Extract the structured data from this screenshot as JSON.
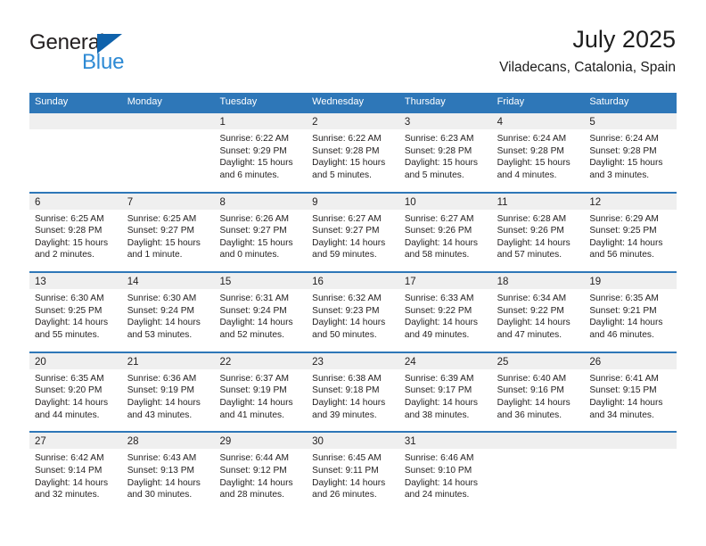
{
  "brand": {
    "name_part1": "General",
    "name_part2": "Blue",
    "accent_color": "#2e8ad4",
    "triangle_color": "#0f62ab"
  },
  "header": {
    "title": "July 2025",
    "subtitle": "Viladecans, Catalonia, Spain"
  },
  "calendar": {
    "header_color": "#2e77b8",
    "band_color": "#efefef",
    "weekdays": [
      "Sunday",
      "Monday",
      "Tuesday",
      "Wednesday",
      "Thursday",
      "Friday",
      "Saturday"
    ],
    "weeks": [
      [
        {
          "day": "",
          "sunrise": "",
          "sunset": "",
          "daylight1": "",
          "daylight2": ""
        },
        {
          "day": "",
          "sunrise": "",
          "sunset": "",
          "daylight1": "",
          "daylight2": ""
        },
        {
          "day": "1",
          "sunrise": "Sunrise: 6:22 AM",
          "sunset": "Sunset: 9:29 PM",
          "daylight1": "Daylight: 15 hours",
          "daylight2": "and 6 minutes."
        },
        {
          "day": "2",
          "sunrise": "Sunrise: 6:22 AM",
          "sunset": "Sunset: 9:28 PM",
          "daylight1": "Daylight: 15 hours",
          "daylight2": "and 5 minutes."
        },
        {
          "day": "3",
          "sunrise": "Sunrise: 6:23 AM",
          "sunset": "Sunset: 9:28 PM",
          "daylight1": "Daylight: 15 hours",
          "daylight2": "and 5 minutes."
        },
        {
          "day": "4",
          "sunrise": "Sunrise: 6:24 AM",
          "sunset": "Sunset: 9:28 PM",
          "daylight1": "Daylight: 15 hours",
          "daylight2": "and 4 minutes."
        },
        {
          "day": "5",
          "sunrise": "Sunrise: 6:24 AM",
          "sunset": "Sunset: 9:28 PM",
          "daylight1": "Daylight: 15 hours",
          "daylight2": "and 3 minutes."
        }
      ],
      [
        {
          "day": "6",
          "sunrise": "Sunrise: 6:25 AM",
          "sunset": "Sunset: 9:28 PM",
          "daylight1": "Daylight: 15 hours",
          "daylight2": "and 2 minutes."
        },
        {
          "day": "7",
          "sunrise": "Sunrise: 6:25 AM",
          "sunset": "Sunset: 9:27 PM",
          "daylight1": "Daylight: 15 hours",
          "daylight2": "and 1 minute."
        },
        {
          "day": "8",
          "sunrise": "Sunrise: 6:26 AM",
          "sunset": "Sunset: 9:27 PM",
          "daylight1": "Daylight: 15 hours",
          "daylight2": "and 0 minutes."
        },
        {
          "day": "9",
          "sunrise": "Sunrise: 6:27 AM",
          "sunset": "Sunset: 9:27 PM",
          "daylight1": "Daylight: 14 hours",
          "daylight2": "and 59 minutes."
        },
        {
          "day": "10",
          "sunrise": "Sunrise: 6:27 AM",
          "sunset": "Sunset: 9:26 PM",
          "daylight1": "Daylight: 14 hours",
          "daylight2": "and 58 minutes."
        },
        {
          "day": "11",
          "sunrise": "Sunrise: 6:28 AM",
          "sunset": "Sunset: 9:26 PM",
          "daylight1": "Daylight: 14 hours",
          "daylight2": "and 57 minutes."
        },
        {
          "day": "12",
          "sunrise": "Sunrise: 6:29 AM",
          "sunset": "Sunset: 9:25 PM",
          "daylight1": "Daylight: 14 hours",
          "daylight2": "and 56 minutes."
        }
      ],
      [
        {
          "day": "13",
          "sunrise": "Sunrise: 6:30 AM",
          "sunset": "Sunset: 9:25 PM",
          "daylight1": "Daylight: 14 hours",
          "daylight2": "and 55 minutes."
        },
        {
          "day": "14",
          "sunrise": "Sunrise: 6:30 AM",
          "sunset": "Sunset: 9:24 PM",
          "daylight1": "Daylight: 14 hours",
          "daylight2": "and 53 minutes."
        },
        {
          "day": "15",
          "sunrise": "Sunrise: 6:31 AM",
          "sunset": "Sunset: 9:24 PM",
          "daylight1": "Daylight: 14 hours",
          "daylight2": "and 52 minutes."
        },
        {
          "day": "16",
          "sunrise": "Sunrise: 6:32 AM",
          "sunset": "Sunset: 9:23 PM",
          "daylight1": "Daylight: 14 hours",
          "daylight2": "and 50 minutes."
        },
        {
          "day": "17",
          "sunrise": "Sunrise: 6:33 AM",
          "sunset": "Sunset: 9:22 PM",
          "daylight1": "Daylight: 14 hours",
          "daylight2": "and 49 minutes."
        },
        {
          "day": "18",
          "sunrise": "Sunrise: 6:34 AM",
          "sunset": "Sunset: 9:22 PM",
          "daylight1": "Daylight: 14 hours",
          "daylight2": "and 47 minutes."
        },
        {
          "day": "19",
          "sunrise": "Sunrise: 6:35 AM",
          "sunset": "Sunset: 9:21 PM",
          "daylight1": "Daylight: 14 hours",
          "daylight2": "and 46 minutes."
        }
      ],
      [
        {
          "day": "20",
          "sunrise": "Sunrise: 6:35 AM",
          "sunset": "Sunset: 9:20 PM",
          "daylight1": "Daylight: 14 hours",
          "daylight2": "and 44 minutes."
        },
        {
          "day": "21",
          "sunrise": "Sunrise: 6:36 AM",
          "sunset": "Sunset: 9:19 PM",
          "daylight1": "Daylight: 14 hours",
          "daylight2": "and 43 minutes."
        },
        {
          "day": "22",
          "sunrise": "Sunrise: 6:37 AM",
          "sunset": "Sunset: 9:19 PM",
          "daylight1": "Daylight: 14 hours",
          "daylight2": "and 41 minutes."
        },
        {
          "day": "23",
          "sunrise": "Sunrise: 6:38 AM",
          "sunset": "Sunset: 9:18 PM",
          "daylight1": "Daylight: 14 hours",
          "daylight2": "and 39 minutes."
        },
        {
          "day": "24",
          "sunrise": "Sunrise: 6:39 AM",
          "sunset": "Sunset: 9:17 PM",
          "daylight1": "Daylight: 14 hours",
          "daylight2": "and 38 minutes."
        },
        {
          "day": "25",
          "sunrise": "Sunrise: 6:40 AM",
          "sunset": "Sunset: 9:16 PM",
          "daylight1": "Daylight: 14 hours",
          "daylight2": "and 36 minutes."
        },
        {
          "day": "26",
          "sunrise": "Sunrise: 6:41 AM",
          "sunset": "Sunset: 9:15 PM",
          "daylight1": "Daylight: 14 hours",
          "daylight2": "and 34 minutes."
        }
      ],
      [
        {
          "day": "27",
          "sunrise": "Sunrise: 6:42 AM",
          "sunset": "Sunset: 9:14 PM",
          "daylight1": "Daylight: 14 hours",
          "daylight2": "and 32 minutes."
        },
        {
          "day": "28",
          "sunrise": "Sunrise: 6:43 AM",
          "sunset": "Sunset: 9:13 PM",
          "daylight1": "Daylight: 14 hours",
          "daylight2": "and 30 minutes."
        },
        {
          "day": "29",
          "sunrise": "Sunrise: 6:44 AM",
          "sunset": "Sunset: 9:12 PM",
          "daylight1": "Daylight: 14 hours",
          "daylight2": "and 28 minutes."
        },
        {
          "day": "30",
          "sunrise": "Sunrise: 6:45 AM",
          "sunset": "Sunset: 9:11 PM",
          "daylight1": "Daylight: 14 hours",
          "daylight2": "and 26 minutes."
        },
        {
          "day": "31",
          "sunrise": "Sunrise: 6:46 AM",
          "sunset": "Sunset: 9:10 PM",
          "daylight1": "Daylight: 14 hours",
          "daylight2": "and 24 minutes."
        },
        {
          "day": "",
          "sunrise": "",
          "sunset": "",
          "daylight1": "",
          "daylight2": ""
        },
        {
          "day": "",
          "sunrise": "",
          "sunset": "",
          "daylight1": "",
          "daylight2": ""
        }
      ]
    ]
  }
}
